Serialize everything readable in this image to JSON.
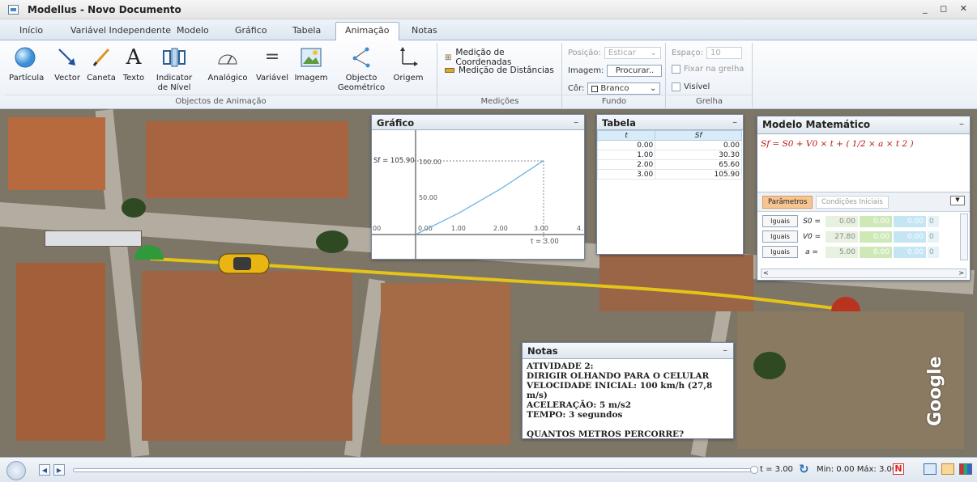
{
  "window": {
    "title": "Modellus - Novo Documento",
    "controls": "_ ◻ ✕"
  },
  "tabs": [
    "Início",
    "Variável Independente",
    "Modelo",
    "Gráfico",
    "Tabela",
    "Animação",
    "Notas"
  ],
  "active_tab": "Animação",
  "ribbon": {
    "objects_tools": [
      "Partícula",
      "Vector",
      "Caneta",
      "Texto",
      "Indicator de Nível",
      "Analógico",
      "Variável",
      "Imagem",
      "Objecto Geométrico",
      "Origem"
    ],
    "objects_group_label": "Objectos de Animação",
    "measurements": [
      "Medição de Coordenadas",
      "Medição de Distâncias"
    ],
    "measurements_label": "Medições",
    "fundo": {
      "position_label": "Posição:",
      "position_value": "Esticar",
      "image_label": "Imagem:",
      "image_button": "Procurar..",
      "color_label": "Côr:",
      "color_value": "Branco",
      "label": "Fundo"
    },
    "grelha": {
      "spacing_label": "Espaço:",
      "spacing_value": "10",
      "snap_label": "Fixar na grelha",
      "visible_label": "Visível",
      "label": "Grelha"
    }
  },
  "grafico": {
    "title": "Gráfico",
    "y_marker": "Sf = 105.90",
    "y_ticks": [
      "100.00",
      "50.00"
    ],
    "x_ticks": [
      "00",
      "0.00",
      "1.00",
      "2.00",
      "3.00",
      "4."
    ],
    "t_label": "t = 3.00"
  },
  "tabela": {
    "title": "Tabela",
    "headers": [
      "t",
      "Sf"
    ],
    "rows": [
      [
        "0.00",
        "0.00"
      ],
      [
        "1.00",
        "30.30"
      ],
      [
        "2.00",
        "65.60"
      ],
      [
        "3.00",
        "105.90"
      ]
    ]
  },
  "modelo": {
    "title": "Modelo Matemático",
    "equation": "Sf = S0 + V0 × t + ( 1/2 × a × t 2 )",
    "tabs": [
      "Parâmetros",
      "Condições Iniciais"
    ],
    "params": [
      {
        "btn": "Iguais",
        "name": "S0 =",
        "values": [
          "0.00",
          "0.00",
          "0.00",
          "0"
        ]
      },
      {
        "btn": "Iguais",
        "name": "V0 =",
        "values": [
          "27.80",
          "0.00",
          "0.00",
          "0"
        ]
      },
      {
        "btn": "Iguais",
        "name": "a =",
        "values": [
          "5.00",
          "0.00",
          "0.00",
          "0"
        ]
      }
    ]
  },
  "notas": {
    "title": "Notas",
    "lines": [
      "ATIVIDADE 2:",
      "DIRIGIR OLHANDO PARA O CELULAR",
      "VELOCIDADE INICIAL: 100 km/h (27,8 m/s)",
      "ACELERAÇÃO: 5 m/s2",
      "TEMPO: 3 segundos",
      "",
      "QUANTOS METROS PERCORRE?"
    ]
  },
  "status": {
    "t_value": "t = 3.00",
    "range": "Min: 0.00 Máx: 3.00"
  },
  "map_watermark": "Google",
  "chart_data": {
    "type": "line",
    "x": [
      0,
      1,
      2,
      3
    ],
    "series": [
      {
        "values": [
          0,
          30.3,
          65.6,
          105.9
        ]
      }
    ],
    "xlim": [
      0,
      4
    ],
    "ylim": [
      -20,
      130
    ]
  }
}
